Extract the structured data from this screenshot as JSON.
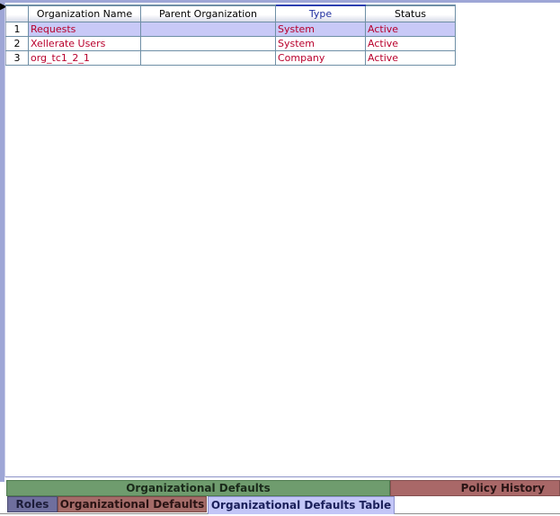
{
  "table": {
    "columns": [
      "",
      "Organization Name",
      "Parent Organization",
      "Type",
      "Status"
    ],
    "rows": [
      {
        "num": "1",
        "name": "Requests",
        "parent": "",
        "type": "System",
        "status": "Active"
      },
      {
        "num": "2",
        "name": "Xellerate Users",
        "parent": "",
        "type": "System",
        "status": "Active"
      },
      {
        "num": "3",
        "name": "org_tc1_2_1",
        "parent": "",
        "type": "Company",
        "status": "Active"
      }
    ]
  },
  "tabs": {
    "top": [
      "Organizational Defaults",
      "Policy History"
    ],
    "bottom": [
      "Roles",
      "Organizational Defaults",
      "Organizational Defaults Table"
    ]
  },
  "colors": {
    "cell_text": "#b8002c",
    "selected_row": "#c8c9f7",
    "tab_green": "#6f9c6e",
    "tab_red": "#a96868",
    "tab_blue_active": "#c3c6f7",
    "tab_purple": "#6f6f9e"
  },
  "icons": {
    "pointer": "mouse-pointer-icon"
  }
}
